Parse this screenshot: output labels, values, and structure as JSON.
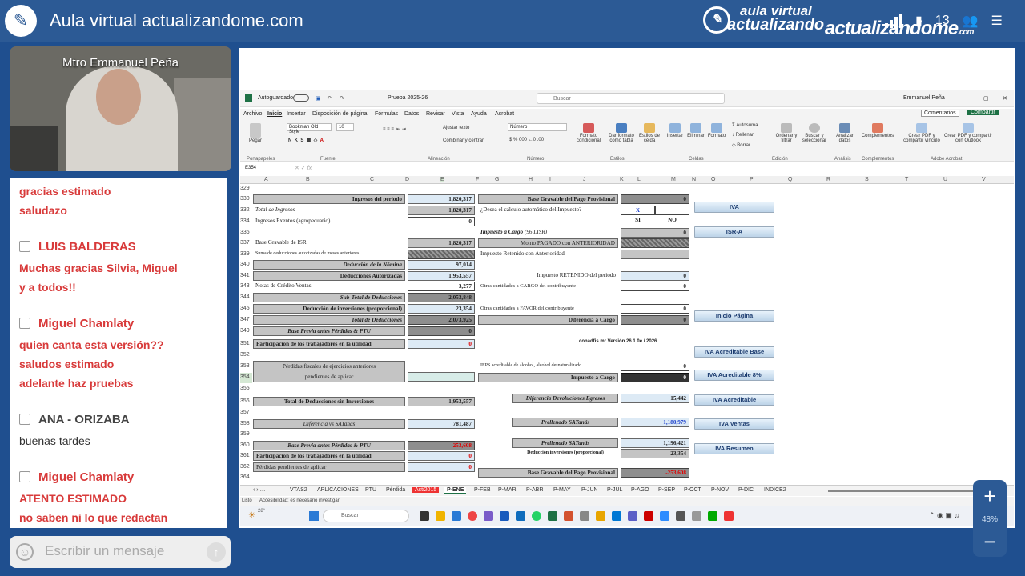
{
  "header": {
    "title": "Aula virtual actualizandome.com",
    "brand_line1": "aula virtual",
    "brand_line2": "actualizando",
    "brand_main": "actualizandome",
    "brand_suffix": ".com",
    "participants": "13"
  },
  "video": {
    "speaker": "Mtro Emmanuel Peña"
  },
  "chat": {
    "messages": [
      {
        "line1": "gracias estimado",
        "line2": "saludazo"
      },
      {
        "author": "LUIS BALDERAS",
        "line1": "Muchas gracias Silvia, Miguel",
        "line2": "y a todos!!"
      },
      {
        "author": "Miguel Chamlaty",
        "line1": "quien canta esta versión??",
        "line2": "saludos estimado",
        "line3": "adelante haz pruebas"
      },
      {
        "author": "ANA - ORIZABA",
        "line1": "buenas tardes"
      },
      {
        "author": "Miguel Chamlaty",
        "line1": "ATENTO ESTIMADO",
        "line2": "no saben ni lo que redactan"
      }
    ],
    "input_placeholder": "Escribir un mensaje"
  },
  "excel": {
    "autosave": "Autoguardado",
    "filename": "Prueba 2025-26",
    "search": "Buscar",
    "user": "Emmanuel Peña",
    "menu": [
      "Archivo",
      "Inicio",
      "Insertar",
      "Disposición de página",
      "Fórmulas",
      "Datos",
      "Revisar",
      "Vista",
      "Ayuda",
      "Acrobat"
    ],
    "comments": "Comentarios",
    "share": "Compartir",
    "ribbon": {
      "paste": "Pegar",
      "font_name": "Bookman Old Style",
      "font_size": "10",
      "wrap": "Ajustar texto",
      "merge": "Combinar y centrar",
      "number_format": "Número",
      "cond_format": "Formato condicional",
      "table_format": "Dar formato como tabla",
      "cell_styles": "Estilos de celda",
      "insert": "Insertar",
      "delete": "Eliminar",
      "format": "Formato",
      "autosum": "Autosuma",
      "fill": "Rellenar",
      "clear": "Borrar",
      "sort": "Ordenar y filtrar",
      "find": "Buscar y seleccionar",
      "analyze": "Analizar datos",
      "addins": "Complementos",
      "pdf_link": "Crear PDF y compartir vínculo",
      "pdf_outlook": "Crear PDF y compartir con Outlook",
      "groups": [
        "Portapapeles",
        "Fuente",
        "Alineación",
        "Número",
        "Estilos",
        "Celdas",
        "Edición",
        "Análisis",
        "Complementos",
        "Adobe Acrobat"
      ]
    },
    "namebox": "E354",
    "columns": [
      "A",
      "B",
      "C",
      "D",
      "E",
      "F",
      "G",
      "H",
      "I",
      "J",
      "K",
      "L",
      "M",
      "N",
      "O",
      "P",
      "Q",
      "R",
      "S",
      "T",
      "U",
      "V"
    ],
    "rows": [
      "329",
      "330",
      "332",
      "334",
      "336",
      "337",
      "339",
      "340",
      "341",
      "343",
      "344",
      "345",
      "347",
      "349",
      "351",
      "352",
      "353",
      "354",
      "355",
      "356",
      "357",
      "358",
      "359",
      "360",
      "361",
      "362",
      "364"
    ],
    "left": {
      "ingresos_periodo": "Ingresos del periodo",
      "ingresos_periodo_v": "1,820,317",
      "total_ingresos": "Total de Ingresos",
      "total_ingresos_v": "1,820,317",
      "ingresos_exentos": "Ingresos Exentos  (agropecuario)",
      "ingresos_exentos_v": "0",
      "base_isr": "Base Gravable de ISR",
      "base_isr_v": "1,820,317",
      "suma_deducciones": "Suma de deducciones autorizadas de meses anteriores",
      "deduccion_nomina": "Deducción de la Nómina",
      "deduccion_nomina_v": "97,014",
      "deducciones_autorizadas": "Deducciones Autorizadas",
      "deducciones_autorizadas_v": "1,953,557",
      "notas_credito": "Notas de Crédito Ventas",
      "notas_credito_v": "3,277",
      "subtotal": "Sub-Total de Deducciones",
      "subtotal_v": "2,053,848",
      "deduccion_inversiones": "Deducción de inversiones (proporcional)",
      "deduccion_inversiones_v": "23,354",
      "total_deducciones": "Total de Deducciones",
      "total_deducciones_v": "2,073,925",
      "base_previa": "Base Previa antes Pérdidas & PTU",
      "base_previa_v": "0",
      "ptu": "Participacion de los trabajadores en la utilidad",
      "ptu_v": "0",
      "perdidas1": "Pérdidas fiscales de ejercicios anteriores",
      "perdidas2": "pendientes de aplicar",
      "total_sin_inv": "Total de Deducciones sin Inversiones",
      "total_sin_inv_v": "1,953,557",
      "diferencia": "Diferencia vs SATanás",
      "diferencia_v": "781,487",
      "base_previa2": "Base Previa antes Pérdidas & PTU",
      "base_previa2_v": "-253,608",
      "ptu2": "Participacion de los trabajadores en la utilidad",
      "ptu2_v": "0",
      "perdidas3": "Pérdidas pendientes de aplicar",
      "perdidas3_v": "0"
    },
    "right": {
      "base_pp": "Base Gravable del Pago Provisional",
      "base_pp_v": "0",
      "calc_auto": "¿Desea el cálculo automático del Impuesto?",
      "mark": "X",
      "si": "SI",
      "no": "NO",
      "impuesto_cargo": "Impuesto  a Cargo",
      "impuesto_cargo_note": "(96 LISR)",
      "impuesto_cargo_v": "0",
      "monto_pagado": "Monto PAGADO con ANTERIORIDAD",
      "impuesto_retenido_ant": "Impuesto Retenido con Anterioridad",
      "impuesto_retenido": "Impuesto RETENIDO del periodo",
      "impuesto_retenido_v": "0",
      "otras_cargo": "Otras cantidades a CARGO del contribuyente",
      "otras_cargo_v": "0",
      "otras_favor": "Otras cantidades a FAVOR del contribuyente",
      "otras_favor_v": "0",
      "diferencia_cargo": "Diferencia a Cargo",
      "diferencia_cargo_v": "0",
      "version": "conadfis mr Versión 26.1.0e  /  2026",
      "ieps": "IEPS acreditable de alcohol, alcohol desnaturalizado",
      "ieps_v": "0",
      "impuesto_cargo2": "Impuesto a Cargo",
      "impuesto_cargo2_v": "0",
      "dif_devoluciones": "Diferencia Devoluciones Egresos",
      "dif_devoluciones_v": "15,442",
      "prellenado1": "Prellenado SATanás",
      "prellenado1_v": "1,180,979",
      "prellenado2": "Prellenado SATanás",
      "prellenado2_v": "1,196,421",
      "deduccion_inv": "Deducción inversiones (proporcional)",
      "deduccion_inv_v": "23,354",
      "base_pp2": "Base Gravable del Pago Provisional",
      "base_pp2_v": "-253,608"
    },
    "buttons": [
      "IVA",
      "ISR-A",
      "Inicio Página",
      "IVA Acreditable Base",
      "IVA Acreditable 8%",
      "IVA Acreditable",
      "IVA Ventas",
      "IVA Resumen"
    ],
    "tabs": [
      "VTAS2",
      "APLICACIONES",
      "PTU",
      "Pérdida",
      "Acti2015",
      "P-ENE",
      "P-FEB",
      "P-MAR",
      "P-ABR",
      "P-MAY",
      "P-JUN",
      "P-JUL",
      "P-AGO",
      "P-SEP",
      "P-OCT",
      "P-NOV",
      "P-DIC",
      "INDICE2"
    ],
    "status_ready": "Listo",
    "status_access": "Accesibilidad: es necesario investigar"
  },
  "taskbar": {
    "search": "Buscar",
    "temp": "28°"
  },
  "zoom": {
    "level": "48%"
  },
  "colors": {
    "brand_blue": "#2c5a95",
    "chat_red": "#d83a3a",
    "excel_green": "#1e7145"
  }
}
